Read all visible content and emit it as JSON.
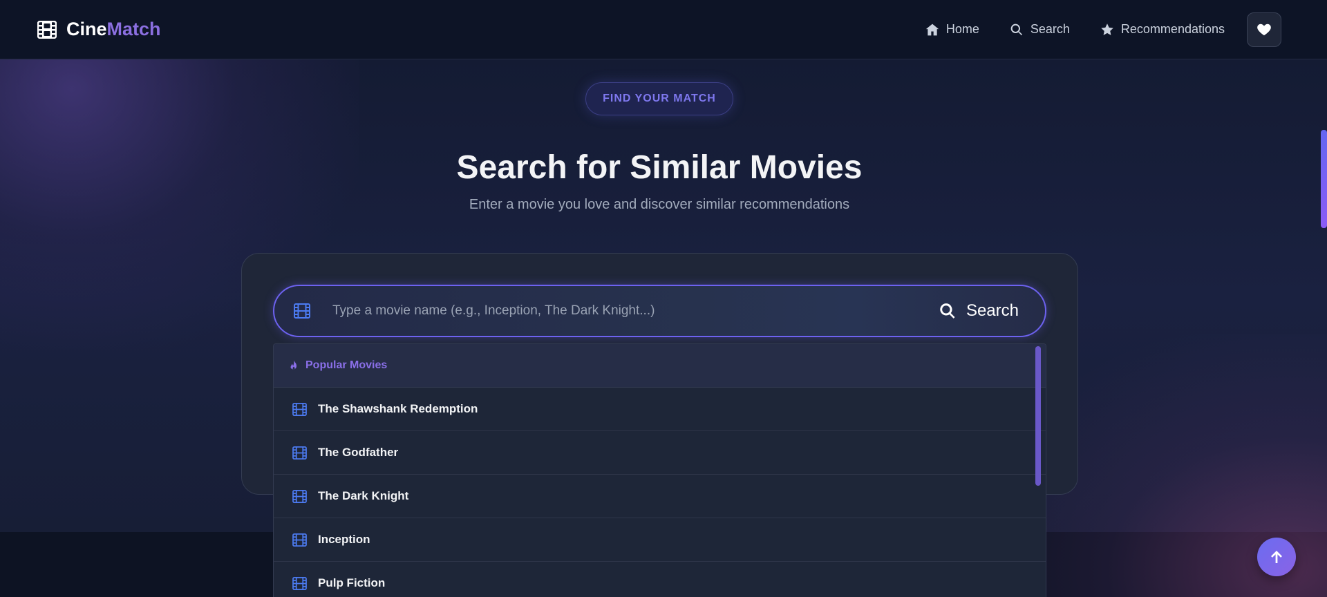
{
  "app": {
    "logo_part1": "Cine",
    "logo_part2": "Match"
  },
  "nav": {
    "home": "Home",
    "search": "Search",
    "recommendations": "Recommendations"
  },
  "hero": {
    "badge": "FIND YOUR MATCH",
    "title": "Search for Similar Movies",
    "subtitle": "Enter a movie you love and discover similar recommendations"
  },
  "search": {
    "placeholder": "Type a movie name (e.g., Inception, The Dark Knight...)",
    "button_label": "Search"
  },
  "dropdown": {
    "header": "Popular Movies",
    "items": [
      {
        "label": "The Shawshank Redemption"
      },
      {
        "label": "The Godfather"
      },
      {
        "label": "The Dark Knight"
      },
      {
        "label": "Inception"
      },
      {
        "label": "Pulp Fiction"
      }
    ]
  },
  "colors": {
    "accent": "#6d62f0",
    "brand_purple": "#8b6fe0",
    "icon_blue": "#4c7bf2",
    "background": "#0f1629"
  }
}
